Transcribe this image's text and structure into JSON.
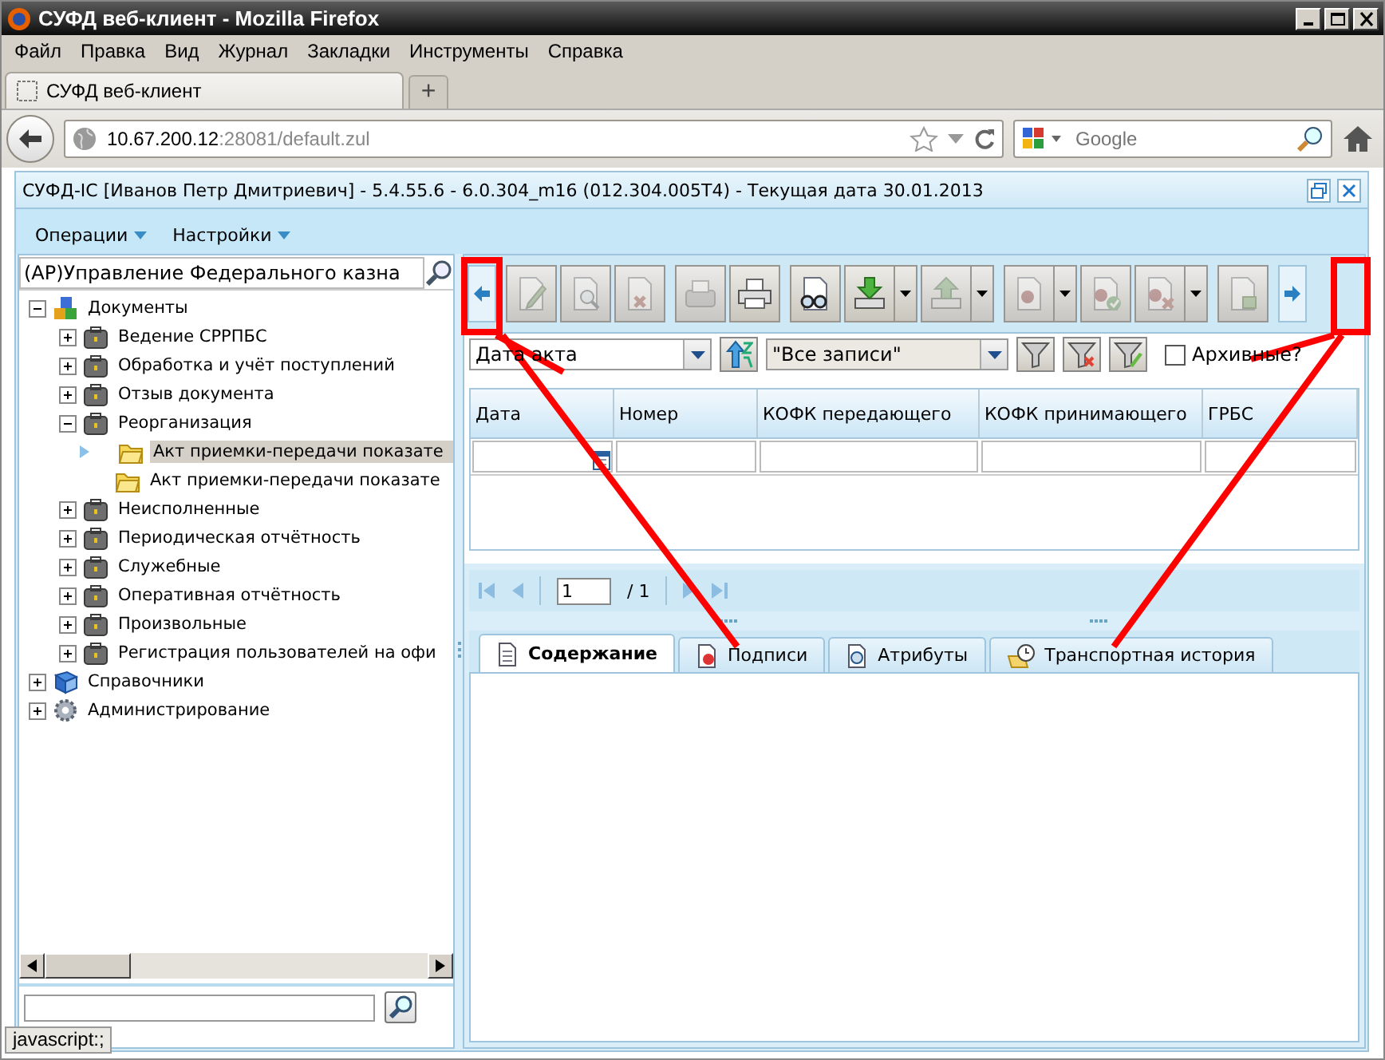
{
  "window": {
    "title": "СУФД веб-клиент - Mozilla Firefox"
  },
  "menu": [
    "Файл",
    "Правка",
    "Вид",
    "Журнал",
    "Закладки",
    "Инструменты",
    "Справка"
  ],
  "browser_tabs": [
    {
      "label": "СУФД веб-клиент",
      "selected": true
    }
  ],
  "new_tab_button": "+",
  "address": {
    "host": "10.67.200.12",
    "path": ":28081/default.zul"
  },
  "search": {
    "placeholder": "Google"
  },
  "app": {
    "title": "СУФД-IC [Иванов Петр Дмитриевич] - 5.4.55.6 - 6.0.304_m16 (012.304.005T4) - Текущая дата 30.01.2013",
    "menu": [
      "Операции",
      "Настройки"
    ]
  },
  "tree": {
    "filter": "(АР)Управление Федерального казна",
    "items": [
      {
        "label": "Документы",
        "kind": "group",
        "expanded": true,
        "selected": false,
        "children": [
          {
            "label": "Ведение СРРПБС",
            "kind": "case",
            "expanded": false,
            "selected": false
          },
          {
            "label": "Обработка и учёт поступлений",
            "kind": "case",
            "expanded": false,
            "selected": false
          },
          {
            "label": "Отзыв документа",
            "kind": "case",
            "expanded": false,
            "selected": false
          },
          {
            "label": "Реорганизация",
            "kind": "case",
            "expanded": true,
            "selected": false,
            "children": [
              {
                "label": "Акт приемки-передачи показате",
                "kind": "folder",
                "selected": true
              },
              {
                "label": "Акт приемки-передачи показате",
                "kind": "folder",
                "selected": false
              }
            ]
          },
          {
            "label": "Неисполненные",
            "kind": "case",
            "expanded": false,
            "selected": false
          },
          {
            "label": "Периодическая отчётность",
            "kind": "case",
            "expanded": false,
            "selected": false
          },
          {
            "label": "Служебные",
            "kind": "case",
            "expanded": false,
            "selected": false
          },
          {
            "label": "Оперативная отчётность",
            "kind": "case",
            "expanded": false,
            "selected": false
          },
          {
            "label": "Произвольные",
            "kind": "case",
            "expanded": false,
            "selected": false
          },
          {
            "label": "Регистрация пользователей на офи",
            "kind": "case",
            "expanded": false,
            "selected": false
          }
        ]
      },
      {
        "label": "Справочники",
        "kind": "book",
        "expanded": false,
        "selected": false
      },
      {
        "label": "Администрирование",
        "kind": "gear",
        "expanded": false,
        "selected": false
      }
    ]
  },
  "toolbar": [
    [
      {
        "kind": "scroll-left"
      }
    ],
    [
      {
        "kind": "edit",
        "disabled": true,
        "dropdown": false
      },
      {
        "kind": "view",
        "disabled": true,
        "dropdown": false
      },
      {
        "kind": "delete",
        "disabled": true,
        "dropdown": false
      }
    ],
    [
      {
        "kind": "fax",
        "disabled": true,
        "dropdown": false
      },
      {
        "kind": "print",
        "disabled": false,
        "dropdown": false
      }
    ],
    [
      {
        "kind": "view-doc",
        "disabled": false,
        "dropdown": false
      },
      {
        "kind": "import",
        "disabled": false,
        "dropdown": true
      },
      {
        "kind": "export",
        "disabled": true,
        "dropdown": true
      }
    ],
    [
      {
        "kind": "sign",
        "disabled": true,
        "dropdown": true
      },
      {
        "kind": "sign-check",
        "disabled": true,
        "dropdown": false
      },
      {
        "kind": "sign-remove",
        "disabled": true,
        "dropdown": true
      }
    ],
    [
      {
        "kind": "report",
        "disabled": true,
        "dropdown": false
      }
    ],
    [
      {
        "kind": "scroll-right"
      }
    ]
  ],
  "filters": {
    "sort": "Дата акта",
    "records": "\"Все записи\"",
    "archived": {
      "label": "Архивные?",
      "checked": false
    }
  },
  "table": {
    "columns": [
      "Дата",
      "Номер",
      "КОФК передающего",
      "КОФК принимающего",
      "ГРБС"
    ]
  },
  "pager": {
    "page": "1",
    "total": "/ 1",
    "nav_disabled": true
  },
  "detail_tabs": [
    {
      "label": "Содержание",
      "selected": true
    },
    {
      "label": "Подписи",
      "selected": false
    },
    {
      "label": "Атрибуты",
      "selected": false
    },
    {
      "label": "Транспортная история",
      "selected": false
    }
  ],
  "status_bar": "javascript:;"
}
